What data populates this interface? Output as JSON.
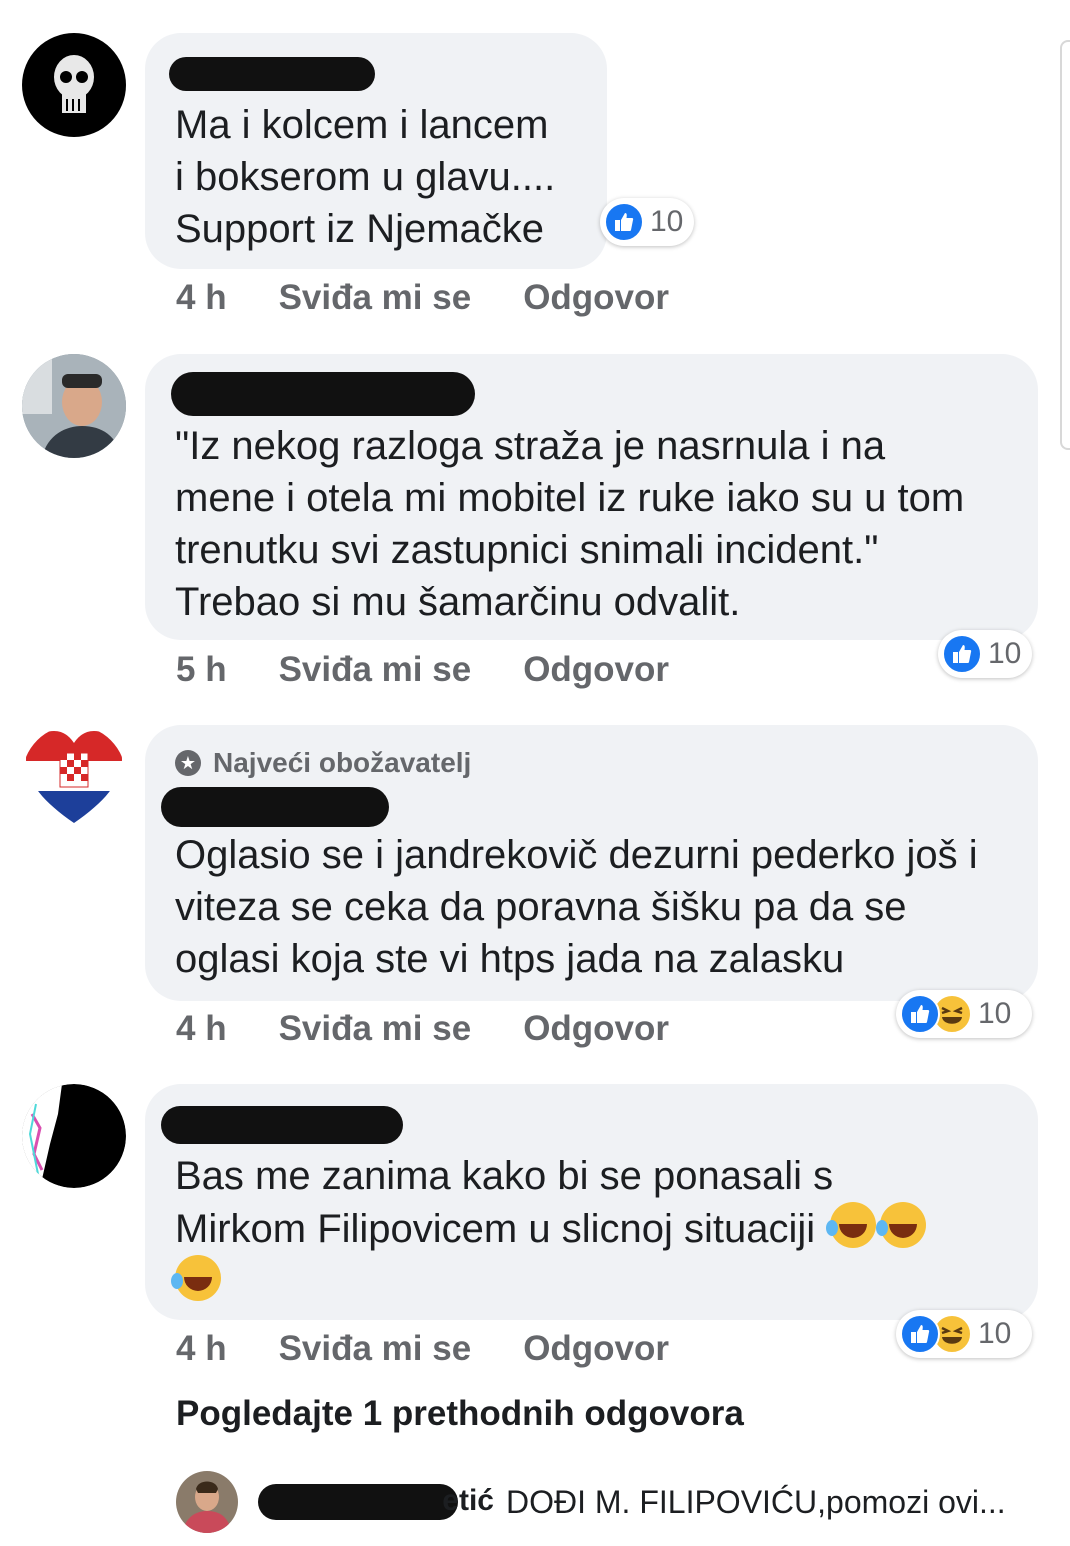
{
  "comments": [
    {
      "text": "Ma i kolcem i lancem\ni bokserom u glavu....\nSupport iz Njemačke",
      "time": "4 h",
      "like_label": "Sviđa mi se",
      "reply_label": "Odgovor",
      "reaction_count": "10",
      "reactions": [
        "like-icon"
      ]
    },
    {
      "text": "\"Iz nekog razloga straža je nasrnula i na\nmene i otela mi mobitel iz ruke iako su u tom\ntrenutku svi zastupnici snimali incident.\"\nTrebao si mu šamarčinu odvalit.",
      "time": "5 h",
      "like_label": "Sviđa mi se",
      "reply_label": "Odgovor",
      "reaction_count": "10",
      "reactions": [
        "like-icon"
      ]
    },
    {
      "badge": "Najveći obožavatelj",
      "text": "Oglasio se i jandrekovič dezurni pederko još i\nviteza se ceka da poravna šišku pa da se\noglasi koja ste vi htps jada na zalasku",
      "time": "4 h",
      "like_label": "Sviđa mi se",
      "reply_label": "Odgovor",
      "reaction_count": "10",
      "reactions": [
        "like-icon",
        "haha-icon"
      ]
    },
    {
      "text_line1": "Bas me zanima kako bi se ponasali s",
      "text_line2": "Mirkom Filipovicem u slicnoj situaciji",
      "time": "4 h",
      "like_label": "Sviđa mi se",
      "reply_label": "Odgovor",
      "reaction_count": "10",
      "reactions": [
        "like-icon",
        "haha-icon"
      ]
    }
  ],
  "view_previous": "Pogledajte 1 prethodnih odgovora",
  "reply_preview": {
    "name_suffix": "etić",
    "text": "DOĐI M. FILIPOVIĆU,pomozi ovi..."
  },
  "colors": {
    "bubble": "#f0f2f5",
    "action_text": "#65676b",
    "like_blue": "#1877f2",
    "haha_yellow": "#f7c23a"
  }
}
